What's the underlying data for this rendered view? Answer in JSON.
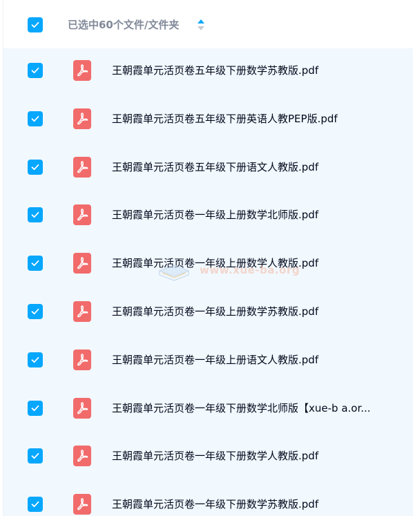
{
  "header": {
    "selection_label": "已选中60个文件/文件夹",
    "select_all_checked": true
  },
  "files": [
    {
      "name": "王朝霞单元活页卷五年级下册数学苏教版.pdf",
      "checked": true,
      "icon": "pdf-icon"
    },
    {
      "name": "王朝霞单元活页卷五年级下册英语人教PEP版.pdf",
      "checked": true,
      "icon": "pdf-icon"
    },
    {
      "name": "王朝霞单元活页卷五年级下册语文人教版.pdf",
      "checked": true,
      "icon": "pdf-icon"
    },
    {
      "name": "王朝霞单元活页卷一年级上册数学北师版.pdf",
      "checked": true,
      "icon": "pdf-icon"
    },
    {
      "name": "王朝霞单元活页卷一年级上册数学人教版.pdf",
      "checked": true,
      "icon": "pdf-icon"
    },
    {
      "name": "王朝霞单元活页卷一年级上册数学苏教版.pdf",
      "checked": true,
      "icon": "pdf-icon"
    },
    {
      "name": "王朝霞单元活页卷一年级上册语文人教版.pdf",
      "checked": true,
      "icon": "pdf-icon"
    },
    {
      "name": "王朝霞单元活页卷一年级下册数学北师版【xue-b a.or...",
      "checked": true,
      "icon": "pdf-icon"
    },
    {
      "name": "王朝霞单元活页卷一年级下册数学人教版.pdf",
      "checked": true,
      "icon": "pdf-icon"
    },
    {
      "name": "王朝霞单元活页卷一年级下册数学苏教版.pdf",
      "checked": true,
      "icon": "pdf-icon"
    }
  ],
  "watermark": {
    "text": "www.xue-ba.org"
  },
  "colors": {
    "accent": "#06a7ff",
    "pdf_icon": "#f26b6b",
    "list_background": "#f1f8fe",
    "header_text": "#818999",
    "file_text": "#03081a"
  }
}
